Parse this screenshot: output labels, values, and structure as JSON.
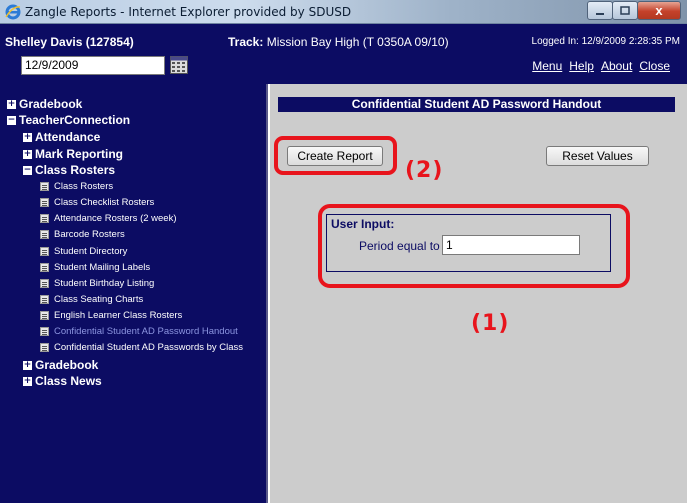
{
  "window": {
    "title": "Zangle Reports - Internet Explorer provided by SDUSD",
    "close_symbol": "x"
  },
  "header": {
    "user": "Shelley Davis (127854)",
    "track_label": "Track:",
    "track_value": "Mission Bay High (T 0350A 09/10)",
    "logged_in": "Logged In: 12/9/2009 2:28:35 PM",
    "date_value": "12/9/2009",
    "menu": [
      "Menu",
      "Help",
      "About",
      "Close"
    ]
  },
  "sidebar": {
    "items": [
      {
        "label": "Gradebook",
        "expander": "+"
      },
      {
        "label": "TeacherConnection",
        "expander": "−"
      },
      {
        "label": "Attendance",
        "expander": "+"
      },
      {
        "label": "Mark Reporting",
        "expander": "+"
      },
      {
        "label": "Class Rosters",
        "expander": "−"
      }
    ],
    "leaves": [
      "Class Rosters",
      "Class Checklist Rosters",
      "Attendance Rosters (2 week)",
      "Barcode Rosters",
      "Student Directory",
      "Student Mailing Labels",
      "Student Birthday Listing",
      "Class Seating Charts",
      "English Learner Class Rosters",
      "Confidential Student AD Password Handout",
      "Confidential Student AD Passwords by Class"
    ],
    "after": [
      {
        "label": "Gradebook",
        "expander": "+"
      },
      {
        "label": "Class News",
        "expander": "+"
      }
    ]
  },
  "main": {
    "report_title": "Confidential Student AD Password Handout",
    "create_label": "Create Report",
    "reset_label": "Reset Values",
    "user_input_heading": "User Input:",
    "period_label": "Period equal to",
    "period_value": "1",
    "annotation_1": "(1)",
    "annotation_2": "(2)"
  },
  "colors": {
    "navy": "#0c0c63",
    "annotation_red": "#e8141c",
    "panel_gray": "#cccccc",
    "active_link": "#8c95e0"
  },
  "icons": [
    "ie-logo-icon",
    "calendar-icon",
    "document-icon",
    "expand-icon",
    "collapse-icon"
  ]
}
